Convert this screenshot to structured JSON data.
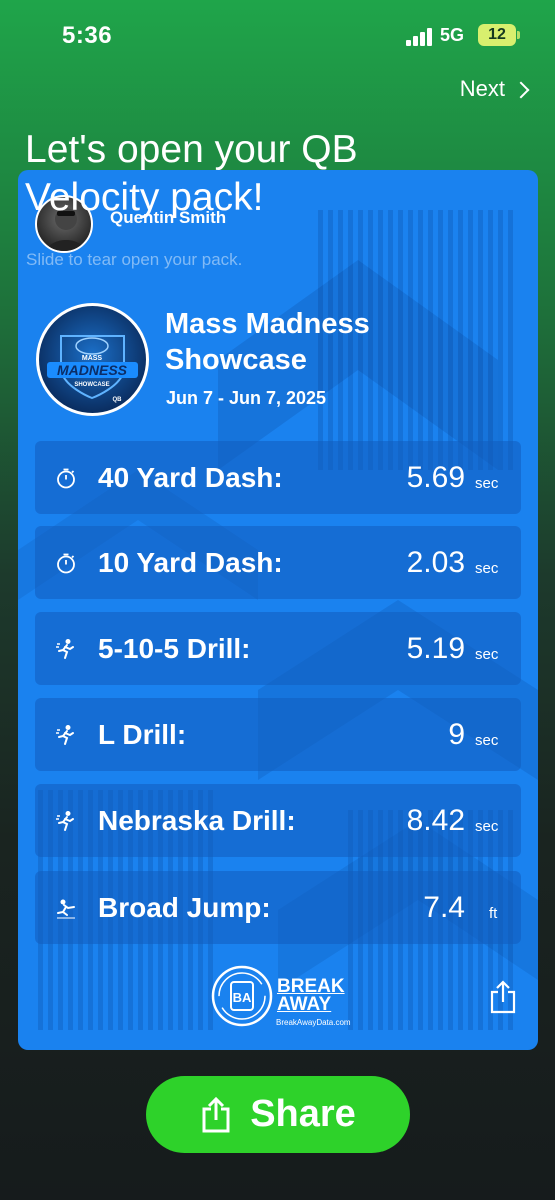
{
  "status_bar": {
    "time": "5:36",
    "network": "5G",
    "battery": "12"
  },
  "header": {
    "next_label": "Next",
    "headline": "Let's open your QB Velocity pack!"
  },
  "card": {
    "player_name": "Quentin Smith",
    "slide_hint": "Slide to tear open your pack.",
    "event": {
      "title": "Mass Madness Showcase",
      "date": "Jun 7 - Jun 7, 2025",
      "logo_text": {
        "top": "MASS",
        "middle": "MADNESS",
        "bottom": "SHOWCASE",
        "corner": "QB"
      }
    },
    "stats": [
      {
        "icon": "stopwatch-icon",
        "label": "40 Yard Dash:",
        "value": "5.69",
        "unit": "sec"
      },
      {
        "icon": "stopwatch-icon",
        "label": "10 Yard Dash:",
        "value": "2.03",
        "unit": "sec"
      },
      {
        "icon": "agility-runner-icon",
        "label": "5-10-5 Drill:",
        "value": "5.19",
        "unit": "sec"
      },
      {
        "icon": "agility-runner-icon",
        "label": "L Drill:",
        "value": "9",
        "unit": "sec"
      },
      {
        "icon": "agility-runner-icon",
        "label": "Nebraska Drill:",
        "value": "8.42",
        "unit": "sec"
      },
      {
        "icon": "broad-jump-icon",
        "label": "Broad Jump:",
        "value": "7.4",
        "unit": "ft"
      }
    ],
    "brand": {
      "name_line1": "BREAK",
      "name_line2": "AWAY",
      "url": "BreakAwayData.com",
      "logo_letters": "BA"
    }
  },
  "share_button": {
    "label": "Share"
  },
  "colors": {
    "card_blue": "#1a82ef",
    "share_green": "#2ed22a",
    "top_green": "#1fa54a"
  }
}
